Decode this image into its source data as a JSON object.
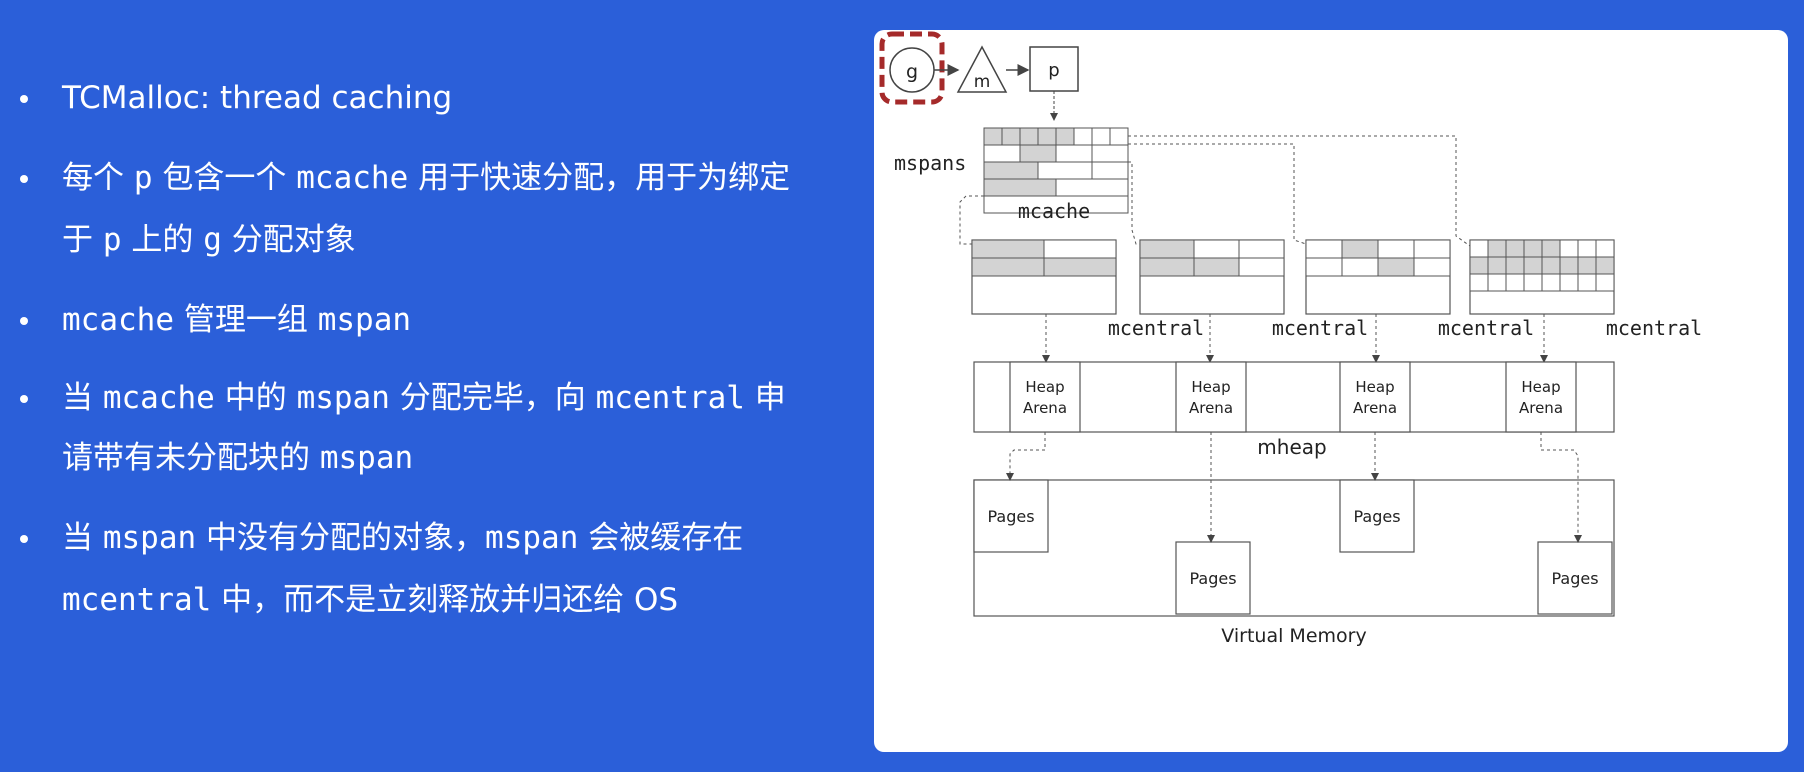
{
  "bullets": [
    {
      "lines": [
        [
          {
            "t": "TCMalloc: thread caching",
            "m": false
          }
        ]
      ]
    },
    {
      "lines": [
        [
          {
            "t": "每个 ",
            "m": false
          },
          {
            "t": "p",
            "m": true
          },
          {
            "t": " 包含一个 ",
            "m": false
          },
          {
            "t": "mcache",
            "m": true
          },
          {
            "t": " 用于快速分配，用于为绑定",
            "m": false
          }
        ],
        [
          {
            "t": "于 ",
            "m": false
          },
          {
            "t": "p",
            "m": true
          },
          {
            "t": " 上的 ",
            "m": false
          },
          {
            "t": "g",
            "m": true
          },
          {
            "t": " 分配对象",
            "m": false
          }
        ]
      ]
    },
    {
      "lines": [
        [
          {
            "t": "mcache",
            "m": true
          },
          {
            "t": " 管理一组 ",
            "m": false
          },
          {
            "t": "mspan",
            "m": true
          }
        ]
      ]
    },
    {
      "lines": [
        [
          {
            "t": "当 ",
            "m": false
          },
          {
            "t": "mcache",
            "m": true
          },
          {
            "t": " 中的 ",
            "m": false
          },
          {
            "t": "mspan",
            "m": true
          },
          {
            "t": " 分配完毕，向 ",
            "m": false
          },
          {
            "t": "mcentral",
            "m": true
          },
          {
            "t": " 申",
            "m": false
          }
        ],
        [
          {
            "t": "请带有未分配块的 ",
            "m": false
          },
          {
            "t": "mspan",
            "m": true
          }
        ]
      ]
    },
    {
      "lines": [
        [
          {
            "t": "当 ",
            "m": false
          },
          {
            "t": "mspan",
            "m": true
          },
          {
            "t": " 中没有分配的对象，",
            "m": false
          },
          {
            "t": "mspan",
            "m": true
          },
          {
            "t": " 会被缓存在",
            "m": false
          }
        ],
        [
          {
            "t": "mcentral",
            "m": true
          },
          {
            "t": " 中，而不是立刻释放并归还给 OS",
            "m": false
          }
        ]
      ]
    }
  ],
  "diagram": {
    "g_label": "g",
    "m_label": "m",
    "p_label": "p",
    "mspans_label": "mspans",
    "mcache_label": "mcache",
    "mcentral_label": "mcentral",
    "heap_arena_line1": "Heap",
    "heap_arena_line2": "Arena",
    "mheap_label": "mheap",
    "pages_label": "Pages",
    "virtual_memory_label": "Virtual Memory",
    "colors": {
      "background": "#2b5fd9",
      "highlight_dashed": "#a52a2a",
      "filled_cell": "#d3d3d3",
      "stroke": "#333333"
    }
  }
}
